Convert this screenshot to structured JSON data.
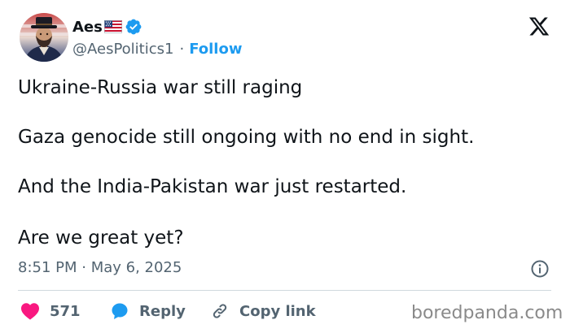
{
  "author": {
    "display_name": "Aes",
    "handle": "@AesPolitics1",
    "separator": "·",
    "follow_label": "Follow",
    "verified": true,
    "flag": "us-flag-emoji"
  },
  "tweet": {
    "lines": [
      "Ukraine-Russia war still raging",
      "Gaza genocide still ongoing with no end in sight.",
      "And the India-Pakistan war just restarted.",
      "Are we great yet?"
    ],
    "timestamp": "8:51 PM · May 6, 2025"
  },
  "actions": {
    "like_count": "571",
    "reply_label": "Reply",
    "copy_link_label": "Copy link"
  },
  "watermark": "boredpanda.com",
  "icons": {
    "logo": "x-logo-icon",
    "verified": "verified-badge-icon",
    "info": "info-icon",
    "like": "heart-icon",
    "reply": "reply-bubble-icon",
    "copy": "link-icon"
  },
  "colors": {
    "text": "#0f1419",
    "secondary": "#536471",
    "accent": "#1d9bf0",
    "like": "#f91880",
    "divider": "#cfd9de",
    "watermark": "#8a8a8a"
  }
}
